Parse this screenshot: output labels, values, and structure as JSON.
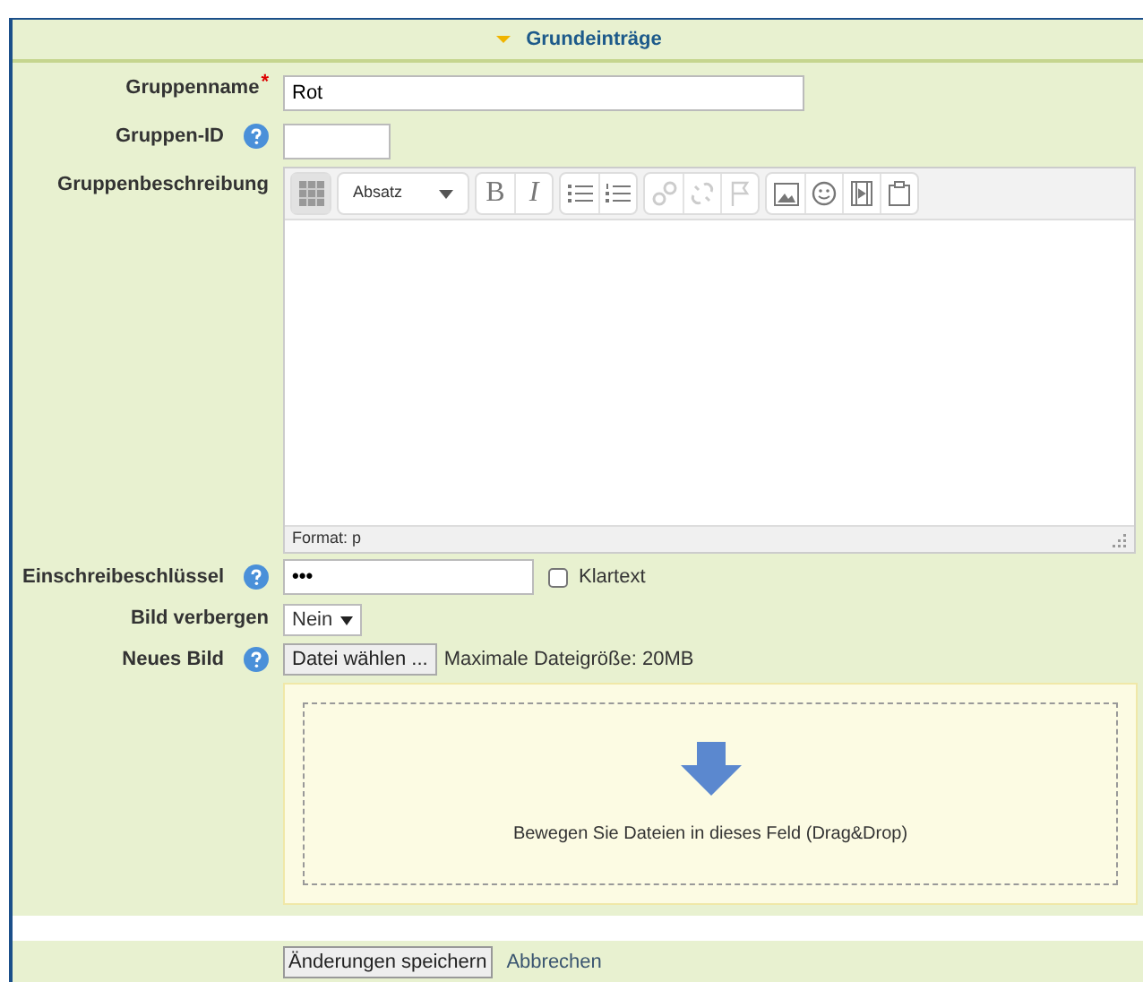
{
  "section": {
    "title": "Grundeinträge",
    "expanded": true
  },
  "required_marker": "*",
  "fields": [
    {
      "kind": "text",
      "label": "Gruppenname",
      "required": true,
      "help": false,
      "value": "Rot"
    },
    {
      "kind": "short",
      "label": "Gruppen-ID",
      "required": false,
      "help": true
    },
    {
      "kind": "editor",
      "label": "Gruppenbeschreibung",
      "required": false,
      "help": false,
      "format": "Absatz",
      "status": "Format: p",
      "toolbar": [
        [
          {
            "kind": "toggle",
            "disabled": false
          }
        ],
        [
          {
            "kind": "select",
            "disabled": false
          }
        ],
        [
          {
            "kind": "bold",
            "text": "B",
            "disabled": false
          },
          {
            "kind": "italic",
            "text": "I",
            "disabled": false
          }
        ],
        [
          {
            "kind": "bullets",
            "disabled": false
          },
          {
            "kind": "numbers",
            "disabled": false
          }
        ],
        [
          {
            "kind": "link",
            "disabled": true
          },
          {
            "kind": "unlink",
            "disabled": true
          },
          {
            "kind": "anchor",
            "disabled": true
          }
        ],
        [
          {
            "kind": "image",
            "disabled": false
          },
          {
            "kind": "emoticon",
            "disabled": false
          },
          {
            "kind": "media",
            "disabled": false
          },
          {
            "kind": "paste",
            "disabled": false
          }
        ]
      ]
    },
    {
      "kind": "password",
      "label": "Einschreibeschlüssel",
      "required": false,
      "help": true,
      "value": "•••",
      "reveal": {
        "label": "Klartext",
        "checked": false
      }
    },
    {
      "kind": "select",
      "label": "Bild verbergen",
      "required": false,
      "help": false,
      "value": "Nein"
    },
    {
      "kind": "file",
      "label": "Neues Bild",
      "required": false,
      "help": true,
      "button": "Datei wählen ...",
      "note": "Maximale Dateigröße: 20MB",
      "drop_text": "Bewegen Sie Dateien in dieses Feld (Drag&Drop)"
    }
  ],
  "actions": [
    {
      "label": "Änderungen speichern",
      "kind": "button"
    },
    {
      "label": "Abbrechen",
      "kind": "link"
    }
  ]
}
